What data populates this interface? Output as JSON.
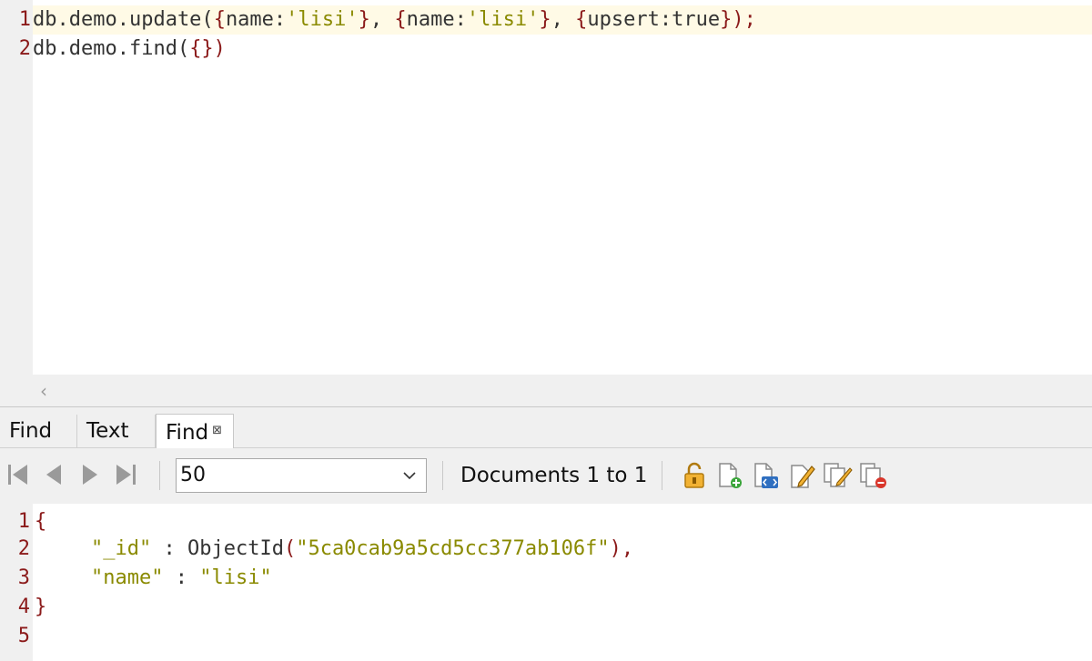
{
  "editor": {
    "line_numbers": [
      "1",
      "2"
    ],
    "line1": {
      "p1": "db.demo.update(",
      "b1": "{",
      "p2": "name:",
      "s1": "'lisi'",
      "b2": "}",
      "p3": ", ",
      "b3": "{",
      "p4": "name:",
      "s2": "'lisi'",
      "b4": "}",
      "p5": ", ",
      "b5": "{",
      "p6": "upsert:true",
      "b6": "});"
    },
    "line2": {
      "p1": "db.demo.find(",
      "b1": "{})"
    }
  },
  "tabs": [
    {
      "label": "Find"
    },
    {
      "label": "Text"
    },
    {
      "label": "Find",
      "close": "⊠"
    }
  ],
  "toolbar": {
    "page_size": "50",
    "documents_label": "Documents 1 to 1",
    "icons": [
      "first-page-icon",
      "previous-page-icon",
      "next-page-icon",
      "last-page-icon",
      "lock-icon",
      "add-document-icon",
      "view-json-icon",
      "edit-document-icon",
      "copy-document-icon",
      "delete-document-icon"
    ]
  },
  "result": {
    "line_numbers": [
      "1",
      "2",
      "3",
      "4",
      "5"
    ],
    "open_brace": "{",
    "id_key": "\"_id\"",
    "colon": " : ",
    "objectid_fn": "ObjectId",
    "objectid_open": "(",
    "objectid_value": "\"5ca0cab9a5cd5cc377ab106f\"",
    "objectid_close": "),",
    "name_key": "\"name\"",
    "name_value": "\"lisi\"",
    "close_brace": "}"
  },
  "colors": {
    "bracket": "#8b1a1a",
    "string": "#8a8a00",
    "current_line": "#fffae6"
  }
}
